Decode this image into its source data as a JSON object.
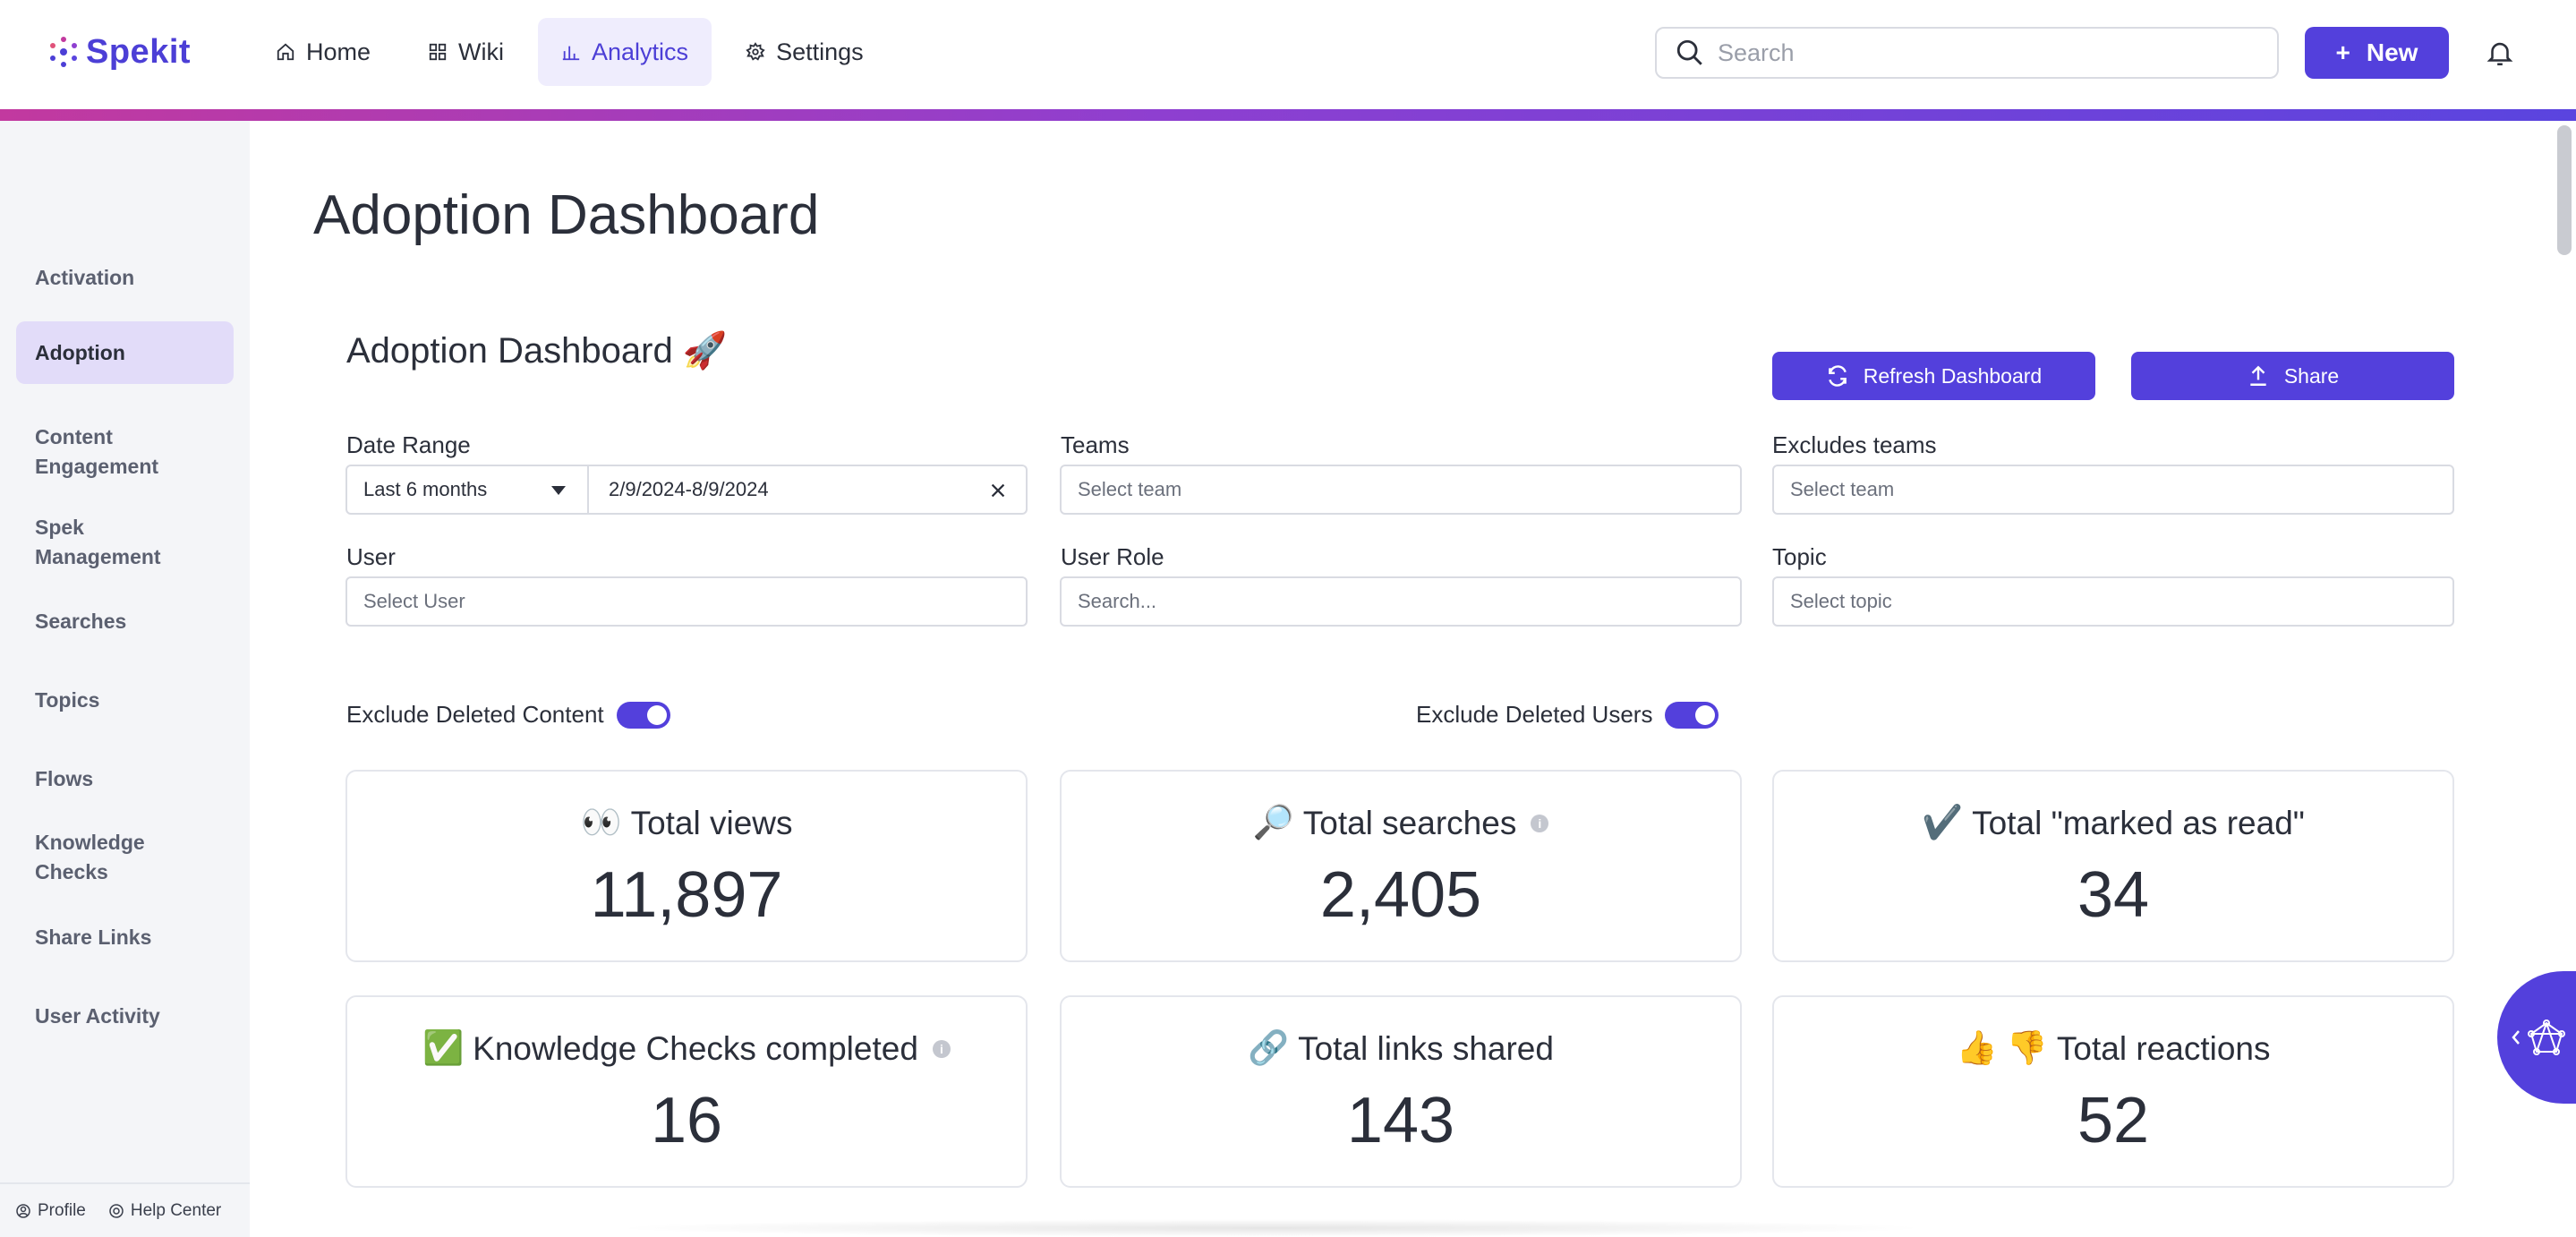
{
  "app": {
    "name": "Spekit"
  },
  "nav": {
    "items": [
      {
        "label": "Home",
        "icon": "home-icon"
      },
      {
        "label": "Wiki",
        "icon": "grid-icon"
      },
      {
        "label": "Analytics",
        "icon": "bar-chart-icon",
        "active": true
      },
      {
        "label": "Settings",
        "icon": "gear-icon"
      }
    ],
    "search_placeholder": "Search",
    "new_label": "New"
  },
  "sidebar": {
    "items": [
      {
        "label": "Activation"
      },
      {
        "label": "Adoption",
        "active": true
      },
      {
        "label": "Content Engagement"
      },
      {
        "label": "Spek Management"
      },
      {
        "label": "Searches"
      },
      {
        "label": "Topics"
      },
      {
        "label": "Flows"
      },
      {
        "label": "Knowledge Checks"
      },
      {
        "label": "Share Links"
      },
      {
        "label": "User Activity"
      }
    ],
    "footer": {
      "profile": "Profile",
      "help": "Help Center"
    }
  },
  "page": {
    "title": "Adoption Dashboard"
  },
  "dashboard": {
    "title": "Adoption Dashboard 🚀",
    "refresh_label": "Refresh Dashboard",
    "share_label": "Share"
  },
  "filters": {
    "date_range": {
      "label": "Date Range",
      "preset": "Last 6 months",
      "value": "2/9/2024-8/9/2024"
    },
    "teams": {
      "label": "Teams",
      "placeholder": "Select team"
    },
    "excludes_teams": {
      "label": "Excludes teams",
      "placeholder": "Select team"
    },
    "user": {
      "label": "User",
      "placeholder": "Select User"
    },
    "user_role": {
      "label": "User Role",
      "placeholder": "Search..."
    },
    "topic": {
      "label": "Topic",
      "placeholder": "Select topic"
    }
  },
  "toggles": {
    "exclude_deleted_content": {
      "label": "Exclude Deleted Content",
      "on": true
    },
    "exclude_deleted_users": {
      "label": "Exclude Deleted Users",
      "on": true
    }
  },
  "metrics": [
    {
      "emoji": "👀",
      "title": "Total views",
      "value": "11,897",
      "info": false
    },
    {
      "emoji": "🔎",
      "title": "Total searches",
      "value": "2,405",
      "info": true
    },
    {
      "emoji": "✔️",
      "title": "Total \"marked as read\"",
      "value": "34",
      "info": false
    },
    {
      "emoji": "✅",
      "title": "Knowledge Checks completed",
      "value": "16",
      "info": true
    },
    {
      "emoji": "🔗",
      "title": "Total links shared",
      "value": "143",
      "info": false
    },
    {
      "emoji": "👍 👎",
      "title": "Total reactions",
      "value": "52",
      "info": false
    }
  ],
  "colors": {
    "accent": "#5340dc",
    "accent_light": "#efedfd",
    "sidebar_bg": "#f4f5f8"
  }
}
